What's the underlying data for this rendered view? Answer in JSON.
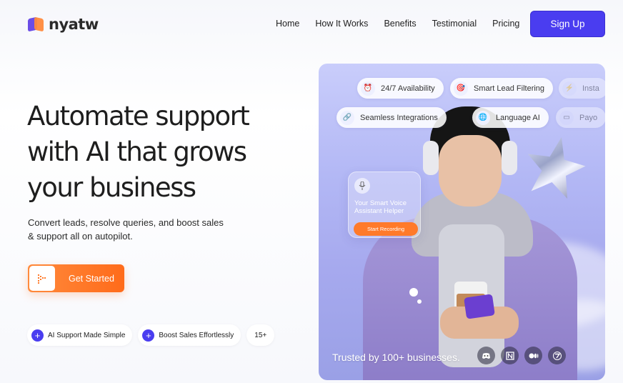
{
  "brand": {
    "name": "nyatw"
  },
  "nav": {
    "items": [
      "Home",
      "How It Works",
      "Benefits",
      "Testimonial",
      "Pricing"
    ],
    "signup_label": "Sign Up"
  },
  "hero": {
    "headline_line1": "Automate support",
    "headline_line2": "with AI that grows",
    "headline_line3": "your business",
    "subtext_line1": "Convert leads, resolve queries, and boost sales",
    "subtext_line2": "& support all on autopilot.",
    "cta_label": "Get Started",
    "pills": [
      "AI Support Made Simple",
      "Boost Sales Effortlessly"
    ],
    "count_badge": "15+"
  },
  "features": {
    "row1": [
      {
        "label": "24/7 Availability",
        "icon": "alarm-clock-icon"
      },
      {
        "label": "Smart Lead Filtering",
        "icon": "target-icon"
      },
      {
        "label": "Insta",
        "icon": "lightning-icon"
      }
    ],
    "row2": [
      {
        "label": "Seamless Integrations",
        "icon": "link-icon"
      },
      {
        "label": "Language AI",
        "icon": "globe-icon"
      },
      {
        "label": "Payo",
        "icon": "card-icon"
      }
    ]
  },
  "voice_widget": {
    "title": "Your Smart Voice Assistant Helper",
    "button_label": "Start Recording"
  },
  "trusted": {
    "text": "Trusted by 100+ businesses.",
    "logos": [
      "discord-icon",
      "notion-icon",
      "medium-icon",
      "webflow-icon"
    ]
  },
  "colors": {
    "primary": "#4a3df0",
    "accent": "#ff7a2a"
  }
}
